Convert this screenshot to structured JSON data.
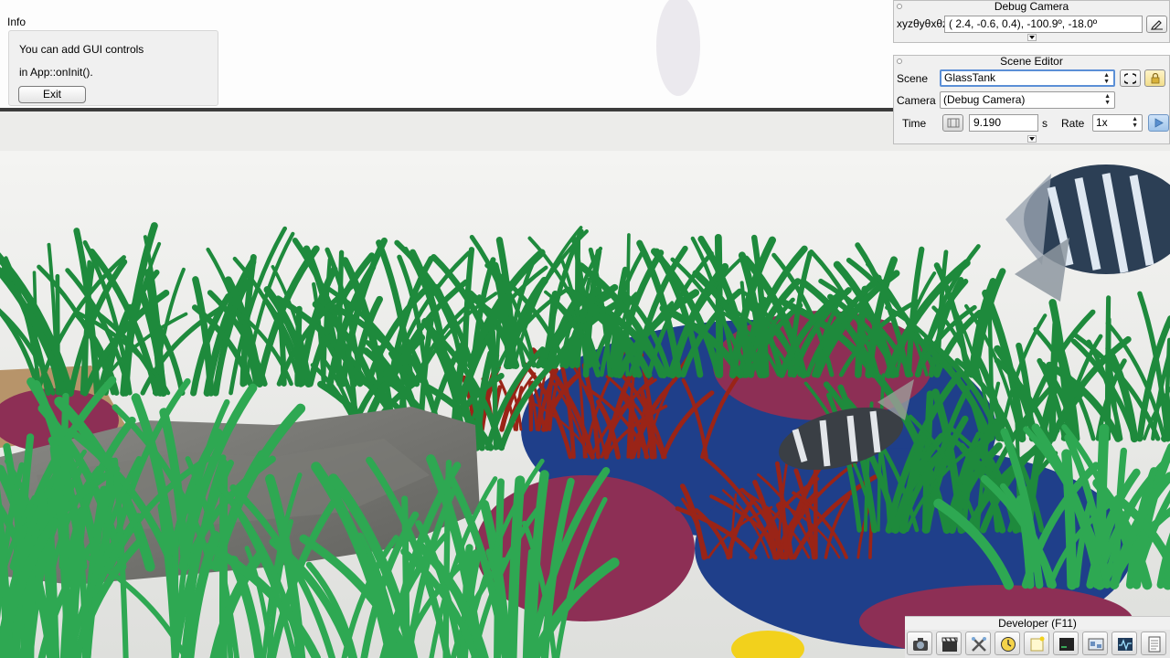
{
  "info": {
    "title": "Info",
    "line1": "You can add GUI controls",
    "line2": "in App::onInit().",
    "exit_label": "Exit"
  },
  "debug_camera": {
    "title": "Debug Camera",
    "label": "xyzθyθxθz",
    "value": "(  2.4,  -0.6,   0.4), -100.9º, -18.0º"
  },
  "scene_editor": {
    "title": "Scene Editor",
    "scene_label": "Scene",
    "scene_value": "GlassTank",
    "camera_label": "Camera",
    "camera_value": "(Debug Camera)",
    "time_label": "Time",
    "time_value": "9.190",
    "time_unit": "s",
    "rate_label": "Rate",
    "rate_value": "1x"
  },
  "developer": {
    "title": "Developer (F11)",
    "tools": [
      "camera-icon",
      "clapperboard-icon",
      "tools-icon",
      "clock-icon",
      "light-icon",
      "console-icon",
      "scene-icon",
      "profiler-icon",
      "document-icon"
    ]
  },
  "colors": {
    "panel": "#f0f0f0",
    "focus": "#5b8fd6",
    "plant_green": "#1e8a3c",
    "coral_blue": "#1f3f8a",
    "coral_red": "#9a2417",
    "coral_pink": "#8d2f55"
  }
}
